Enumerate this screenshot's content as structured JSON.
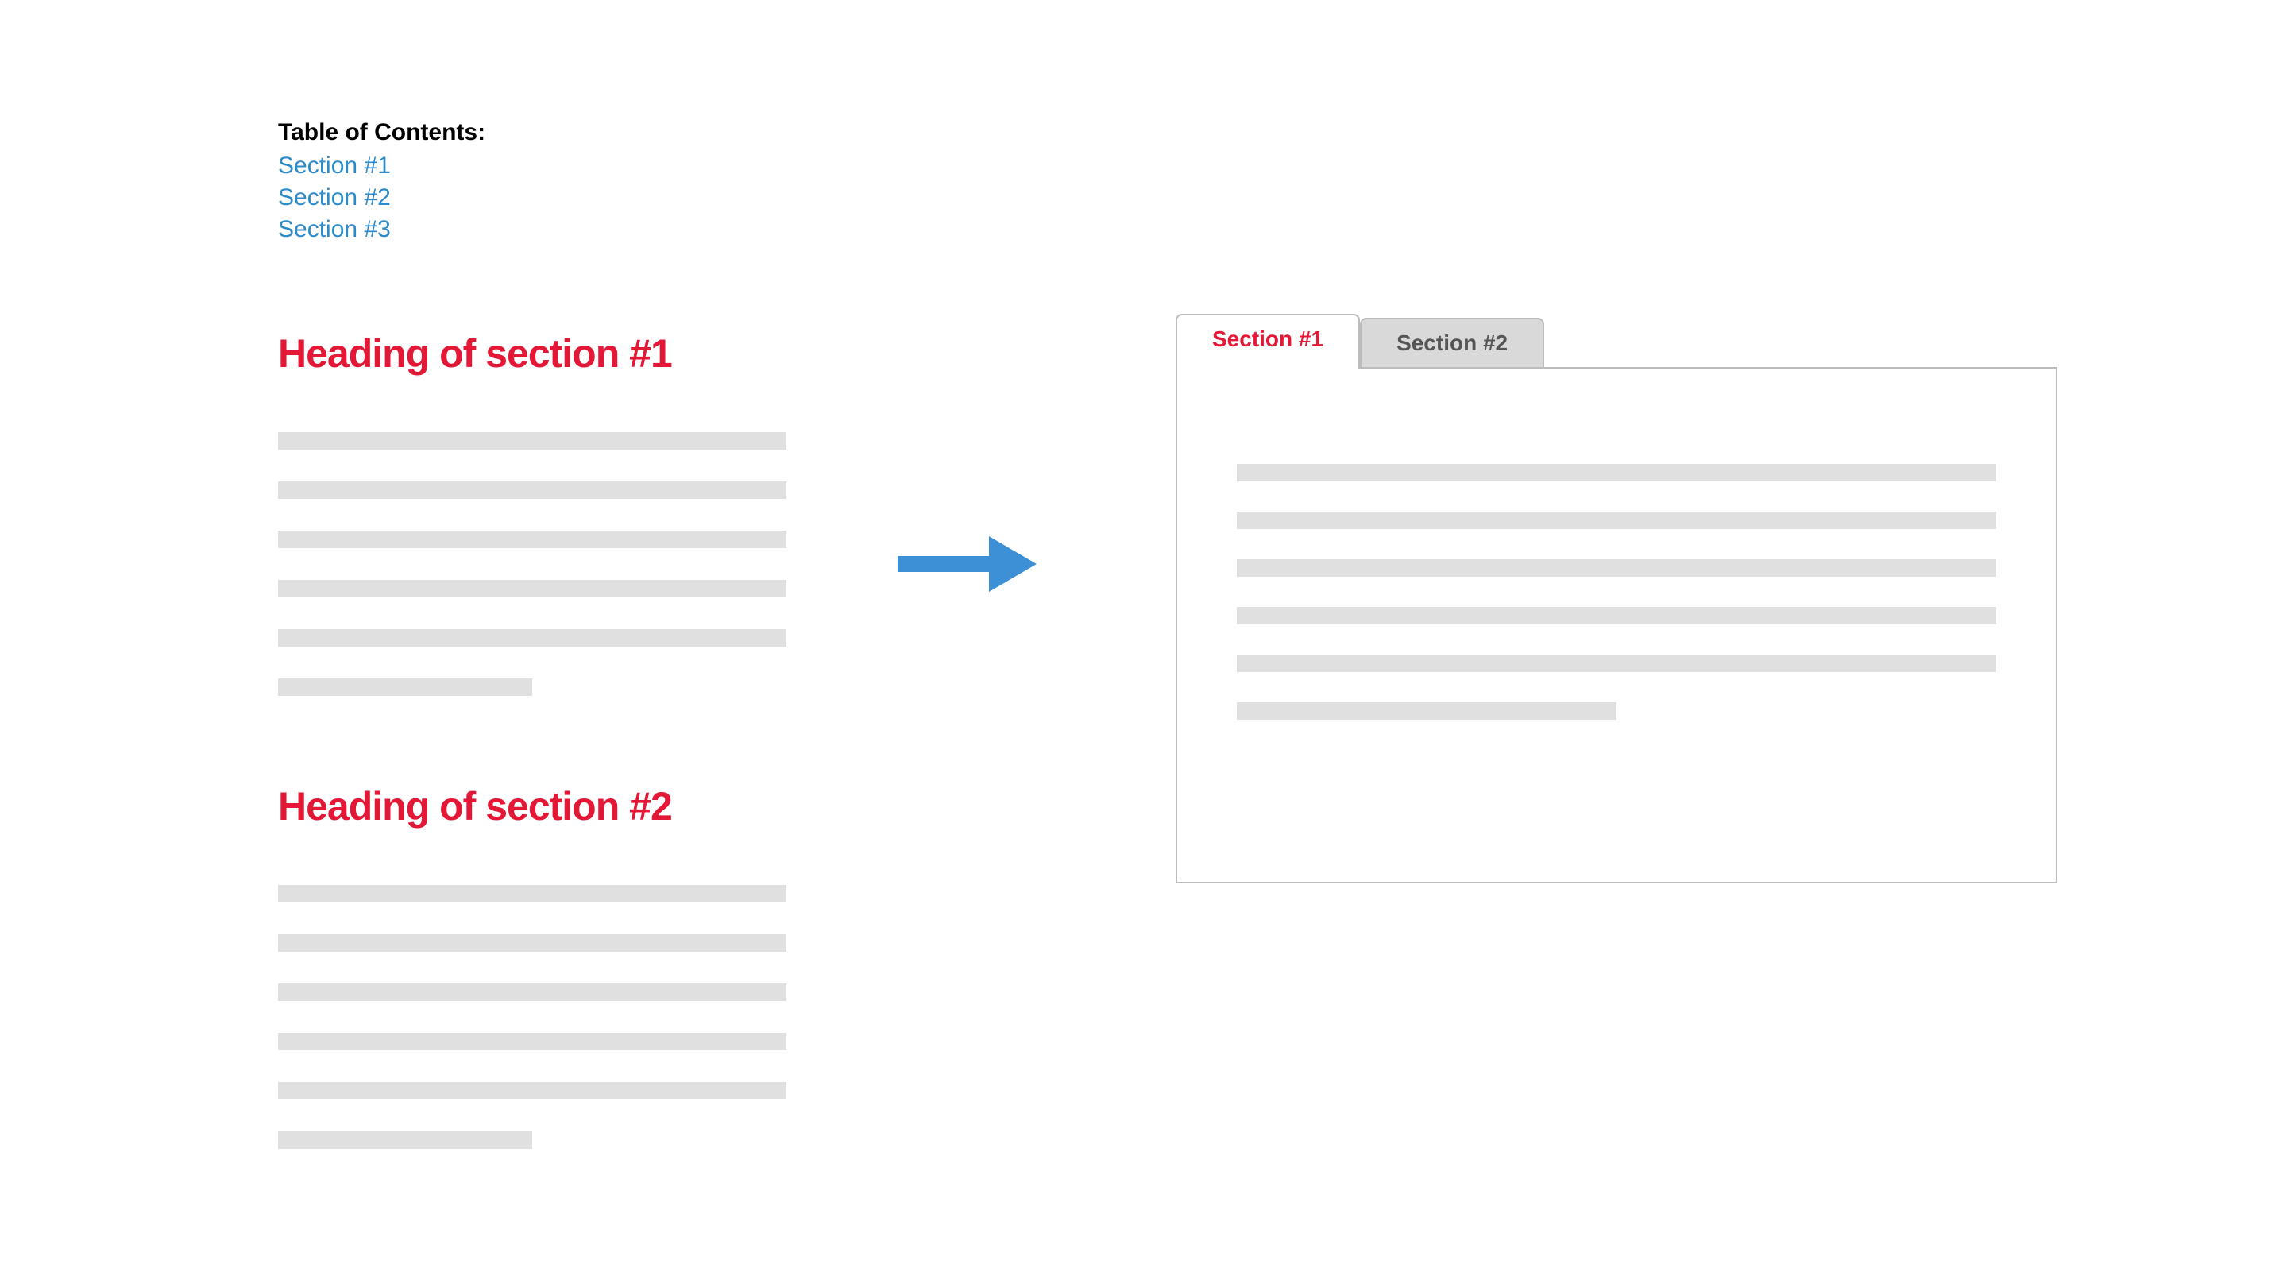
{
  "toc": {
    "title": "Table of Contents:",
    "links": [
      "Section #1",
      "Section #2",
      "Section #3"
    ]
  },
  "sections": [
    {
      "heading": "Heading of section #1"
    },
    {
      "heading": "Heading of section #2"
    }
  ],
  "tabs": [
    {
      "label": "Section #1",
      "active": true
    },
    {
      "label": "Section #2",
      "active": false
    }
  ],
  "colors": {
    "heading_red": "#e31836",
    "link_blue": "#2b8acb",
    "arrow_blue": "#3d8fd6",
    "placeholder": "#e0e0e0",
    "border": "#bcbcbc",
    "tab_inactive_bg": "#d9d9d9"
  }
}
